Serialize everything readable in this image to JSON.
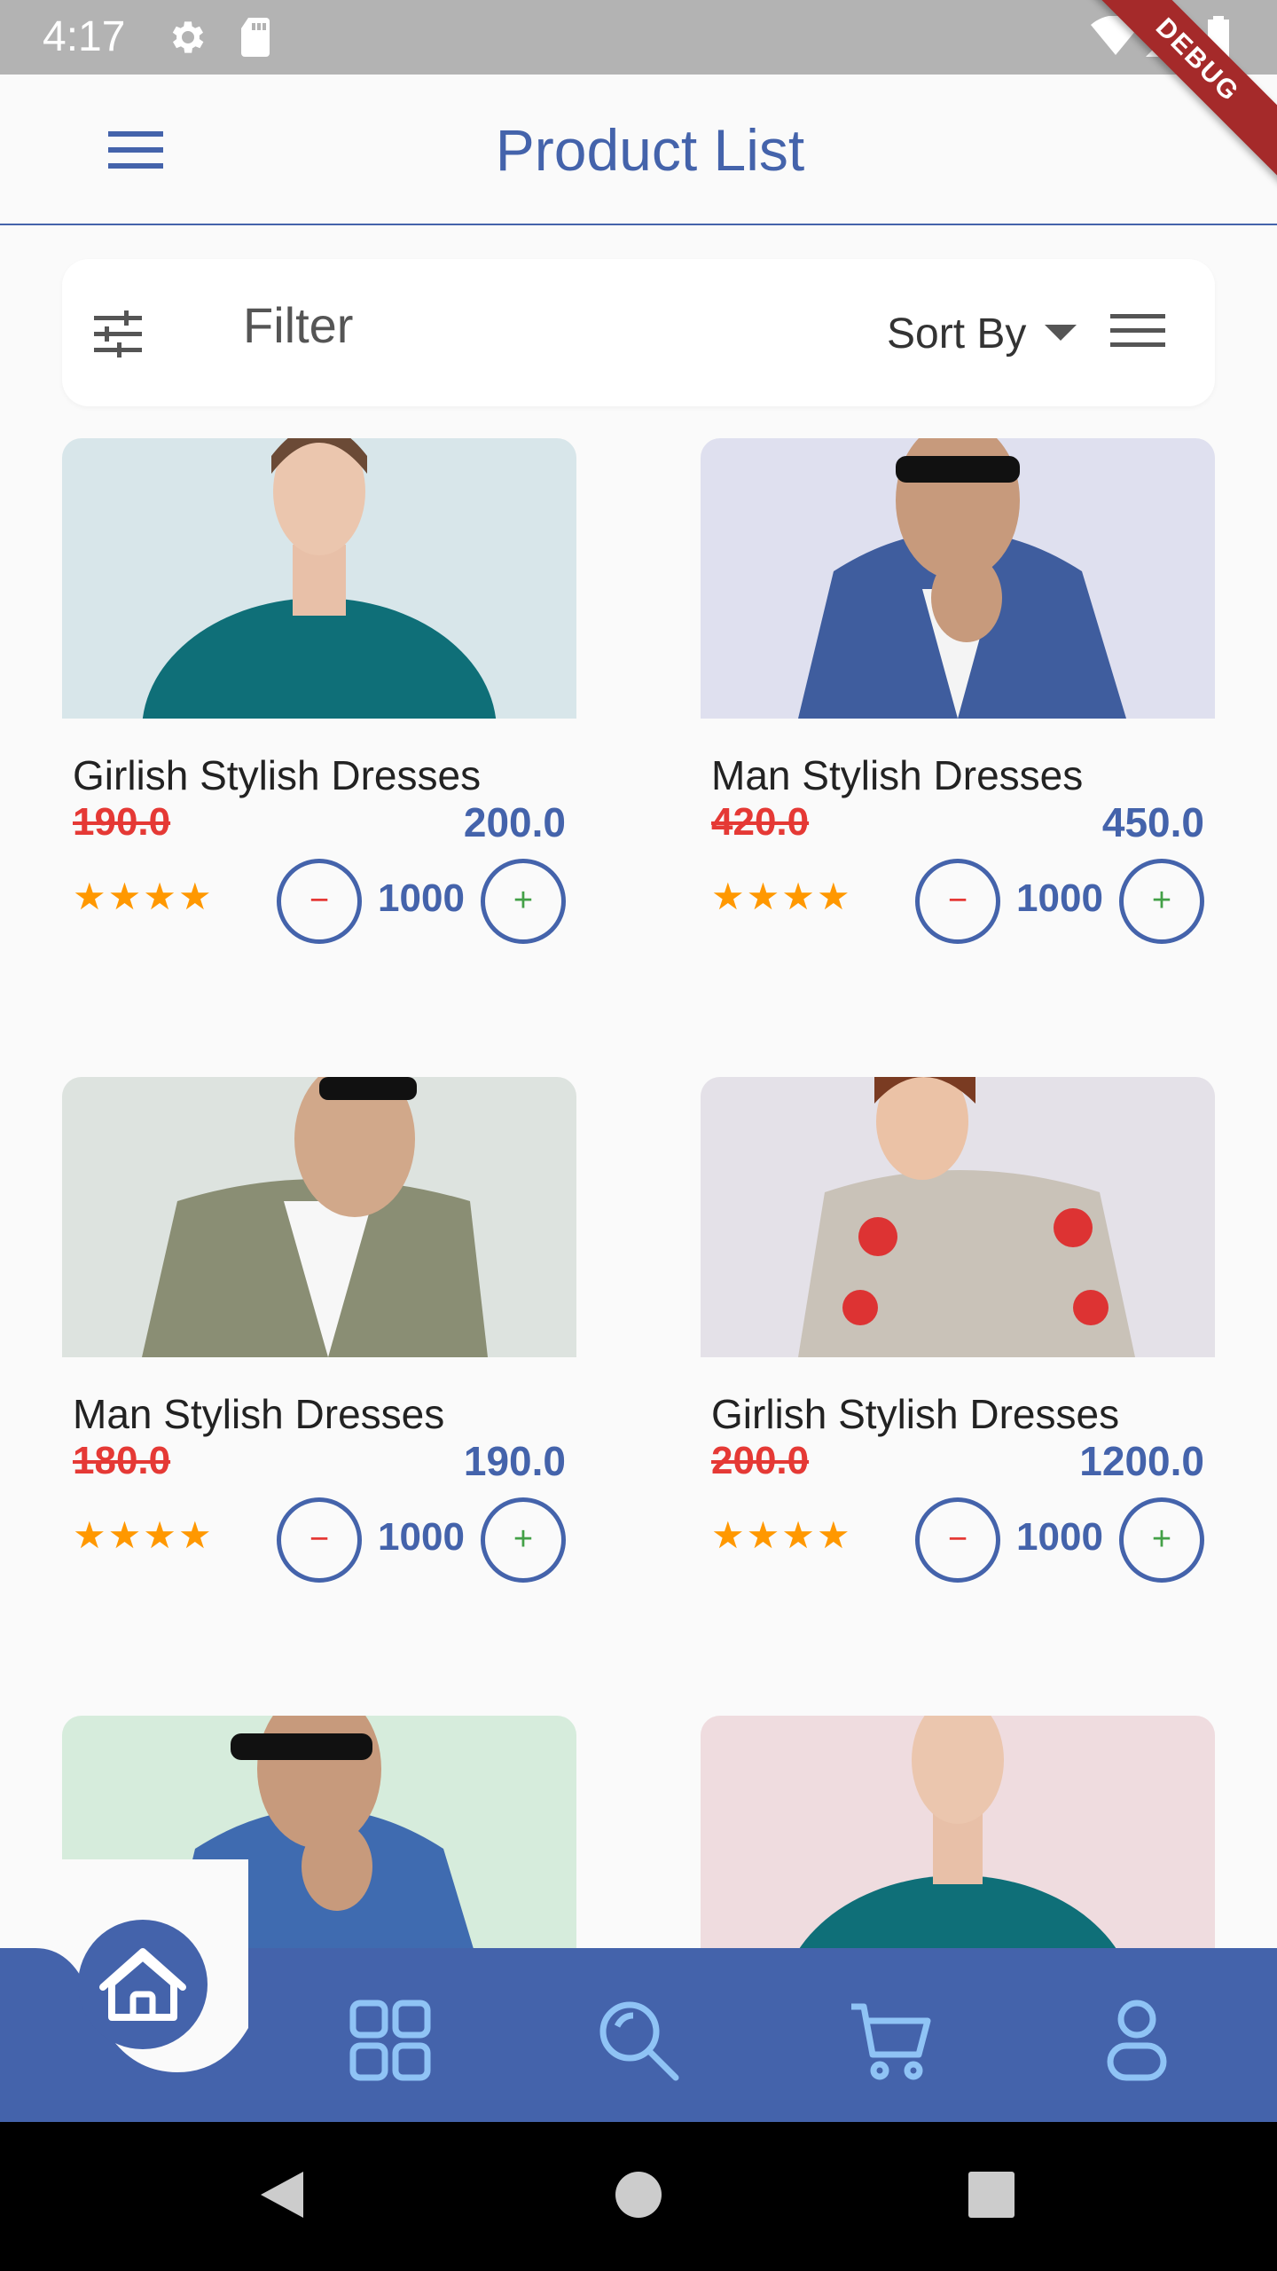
{
  "status_bar": {
    "time": "4:17",
    "icons": [
      "settings-icon",
      "sd-card-icon",
      "wifi-icon",
      "signal-icon",
      "battery-icon"
    ],
    "debug_label": "DEBUG"
  },
  "app_bar": {
    "title": "Product List",
    "menu_icon": "menu-icon"
  },
  "filter_bar": {
    "filter_label": "Filter",
    "sort_label": "Sort By",
    "filter_icon": "sliders-icon",
    "view_icon": "list-view-icon"
  },
  "products": [
    {
      "name": "Girlish Stylish Dresses",
      "old_price": "190.0",
      "new_price": "200.0",
      "rating": "★★★★",
      "quantity": "1000",
      "image_bg": "#d8e6ea"
    },
    {
      "name": "Man Stylish Dresses",
      "old_price": "420.0",
      "new_price": "450.0",
      "rating": "★★★★",
      "quantity": "1000",
      "image_bg": "#dfe0ef"
    },
    {
      "name": "Man Stylish Dresses",
      "old_price": "180.0",
      "new_price": "190.0",
      "rating": "★★★★",
      "quantity": "1000",
      "image_bg": "#dde3df"
    },
    {
      "name": "Girlish Stylish Dresses",
      "old_price": "200.0",
      "new_price": "1200.0",
      "rating": "★★★★",
      "quantity": "1000",
      "image_bg": "#e4e1e8"
    },
    {
      "name": "",
      "old_price": "",
      "new_price": "",
      "rating": "",
      "quantity": "",
      "image_bg": "#d6ecdc"
    },
    {
      "name": "",
      "old_price": "",
      "new_price": "",
      "rating": "",
      "quantity": "",
      "image_bg": "#efdcdf"
    }
  ],
  "qty_controls": {
    "minus": "−",
    "plus": "+"
  },
  "bottom_nav": {
    "items": [
      "home-icon",
      "grid-icon",
      "search-icon",
      "cart-icon",
      "profile-icon"
    ],
    "active": "home-icon"
  },
  "colors": {
    "primary": "#4463ab",
    "old_price": "#e53935",
    "rating": "#ff9800",
    "plus": "#43a047",
    "nav_icon": "#8fc3f5"
  }
}
